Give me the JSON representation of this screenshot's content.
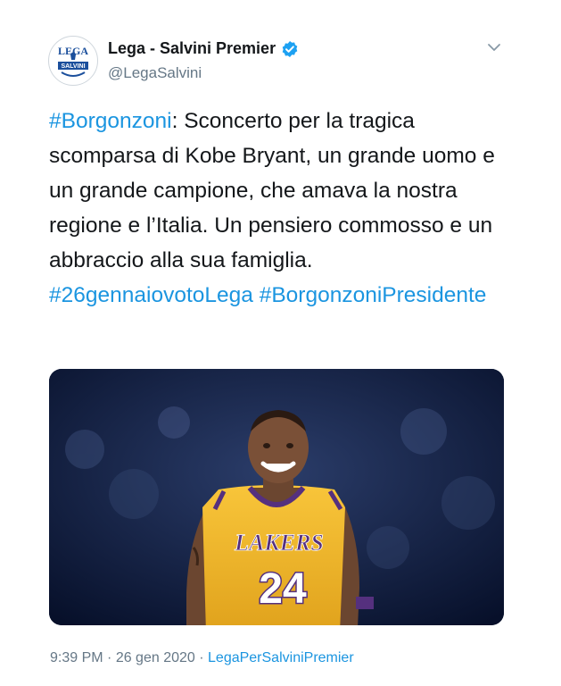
{
  "author": {
    "display_name": "Lega - Salvini Premier",
    "handle": "@LegaSalvini",
    "verified": true,
    "avatar_logo_text": "LEGA",
    "avatar_banner_text": "SALVINI"
  },
  "menu_icon": "chevron-down-icon",
  "tweet": {
    "hashtag_lead": "#Borgonzoni",
    "text_main": ": Sconcerto per la tragica scomparsa di Kobe Bryant, un grande uomo e un grande campione, che amava la nostra regione e l’Italia. Un pensiero commosso e un abbraccio alla sua famiglia. ",
    "hashtag_2": "#26gennaiovotoLega",
    "hashtag_3": "#BorgonzoniPresidente"
  },
  "media": {
    "jersey_team": "LAKERS",
    "jersey_number": "24"
  },
  "footer": {
    "time": "9:39 PM",
    "separator_1": " · ",
    "date": "26 gen 2020",
    "separator_2": " · ",
    "source": "LegaPerSalviniPremier"
  },
  "colors": {
    "link": "#1b95e0",
    "secondary_text": "#657786",
    "jersey_gold": "#f3b92a",
    "jersey_purple": "#55307e"
  }
}
